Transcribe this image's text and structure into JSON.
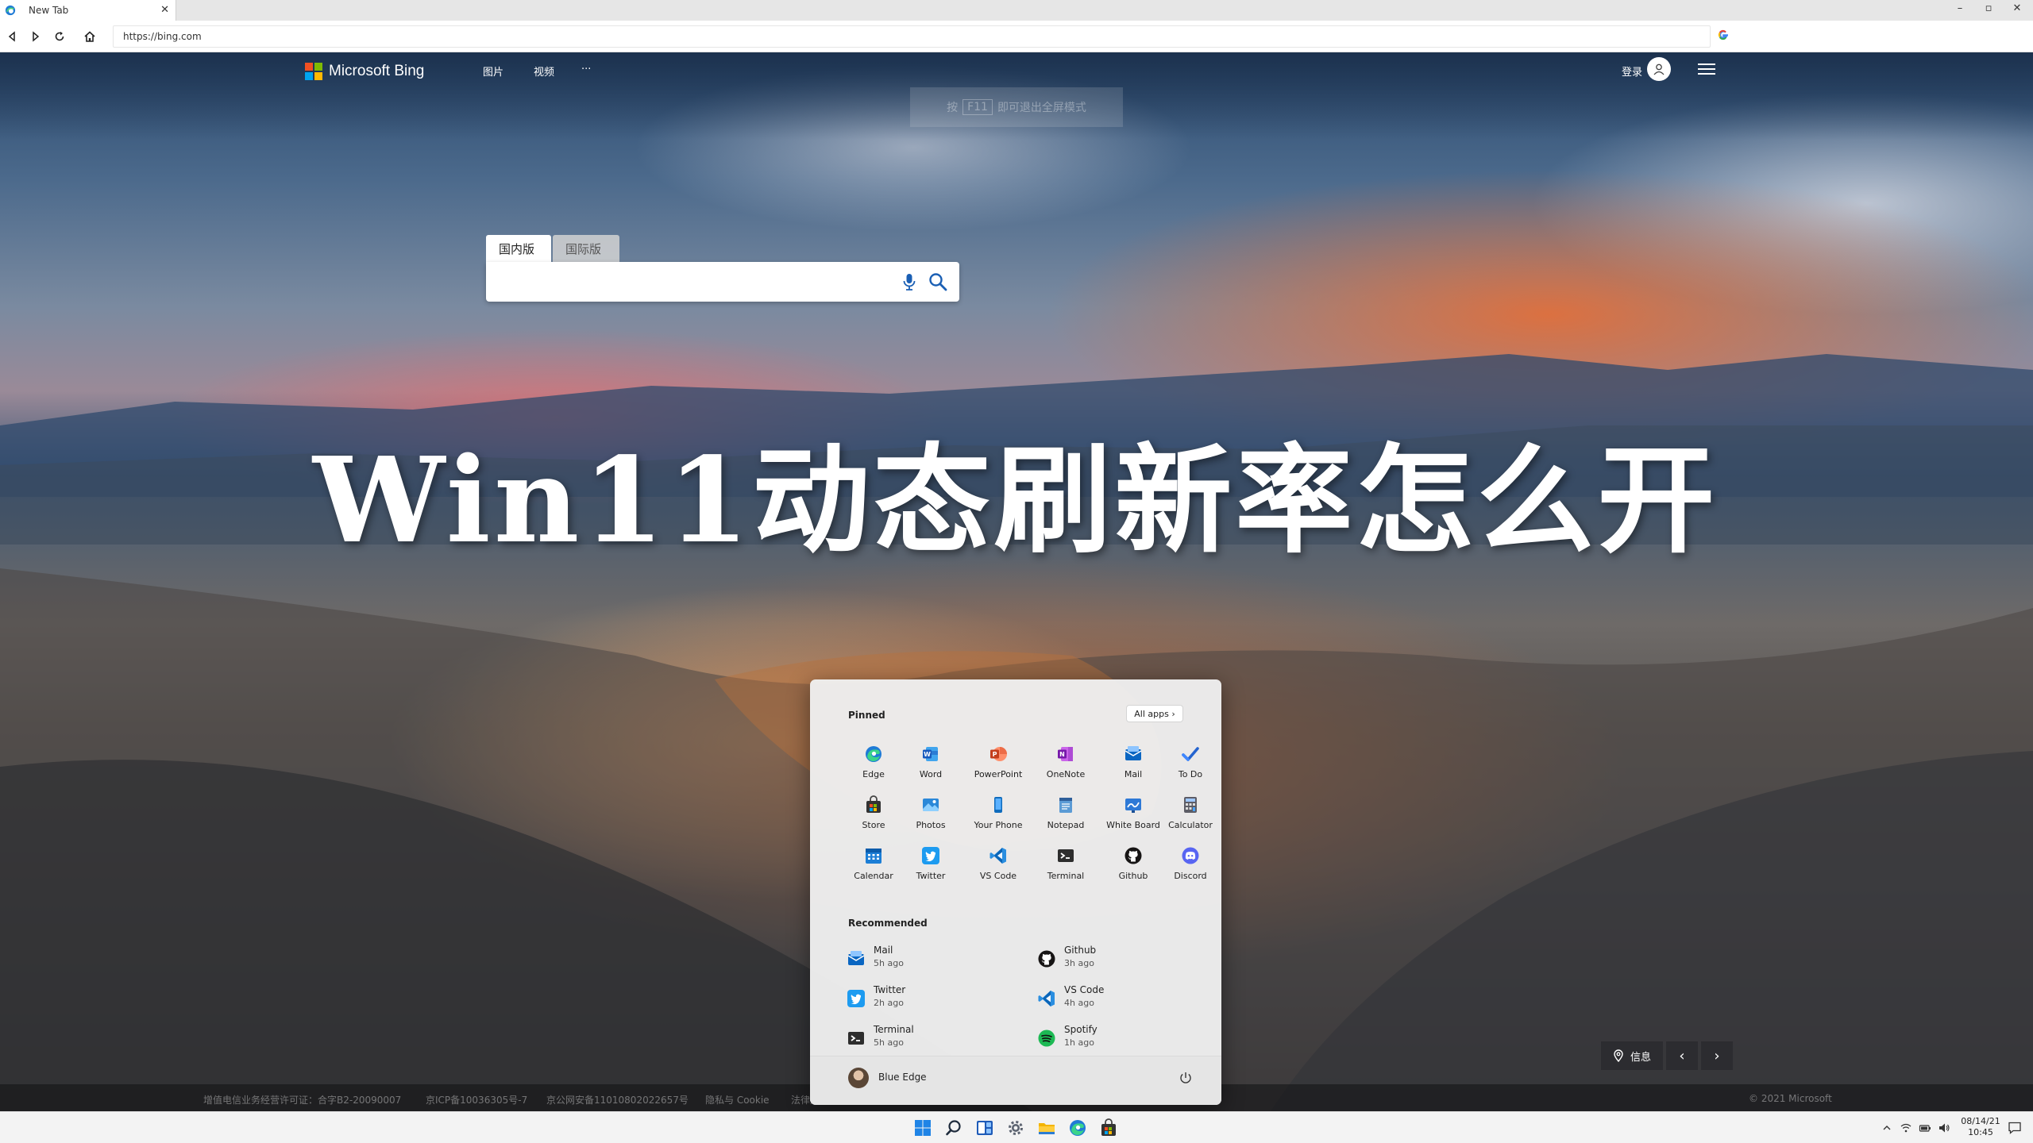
{
  "browser": {
    "tab_title": "New Tab",
    "tab_close": "✕",
    "url": "https://bing.com",
    "window_controls": [
      "–",
      "▫",
      "✕"
    ]
  },
  "bing": {
    "brand": "Microsoft Bing",
    "nav": [
      "图片",
      "视频",
      "···"
    ],
    "login": "登录",
    "scope_tabs": [
      "国内版",
      "国际版"
    ],
    "search_placeholder": "",
    "f11_toast": {
      "pre": "按",
      "key": "F11",
      "post": "即可退出全屏模式"
    },
    "headline": "Win11动态刷新率怎么开",
    "info": "信息",
    "footer": [
      "增值电信业务经营许可证：合字B2-20090007",
      "京ICP备10036305号-7",
      "京公网安备11010802022657号",
      "隐私与 Cookie",
      "法律声明"
    ],
    "copyright": "© 2021 Microsoft",
    "colors": {
      "ms_red": "#f25022",
      "ms_green": "#7fba00",
      "ms_blue": "#00a4ef",
      "ms_yellow": "#ffb900"
    }
  },
  "start_menu": {
    "pinned_label": "Pinned",
    "all_apps": "All apps ›",
    "pinned": [
      {
        "name": "Edge",
        "icon": "edge-icon"
      },
      {
        "name": "Word",
        "icon": "word-icon"
      },
      {
        "name": "PowerPoint",
        "icon": "powerpoint-icon"
      },
      {
        "name": "OneNote",
        "icon": "onenote-icon"
      },
      {
        "name": "Mail",
        "icon": "mail-icon"
      },
      {
        "name": "To Do",
        "icon": "todo-icon"
      },
      {
        "name": "Store",
        "icon": "store-icon"
      },
      {
        "name": "Photos",
        "icon": "photos-icon"
      },
      {
        "name": "Your Phone",
        "icon": "phone-icon"
      },
      {
        "name": "Notepad",
        "icon": "notepad-icon"
      },
      {
        "name": "White Board",
        "icon": "whiteboard-icon"
      },
      {
        "name": "Calculator",
        "icon": "calculator-icon"
      },
      {
        "name": "Calendar",
        "icon": "calendar-icon"
      },
      {
        "name": "Twitter",
        "icon": "twitter-icon"
      },
      {
        "name": "VS Code",
        "icon": "vscode-icon"
      },
      {
        "name": "Terminal",
        "icon": "terminal-icon"
      },
      {
        "name": "Github",
        "icon": "github-icon"
      },
      {
        "name": "Discord",
        "icon": "discord-icon"
      }
    ],
    "recommended_label": "Recommended",
    "recommended": [
      {
        "name": "Mail",
        "time": "5h ago",
        "icon": "mail-icon"
      },
      {
        "name": "Github",
        "time": "3h ago",
        "icon": "github-icon"
      },
      {
        "name": "Twitter",
        "time": "2h ago",
        "icon": "twitter-icon"
      },
      {
        "name": "VS Code",
        "time": "4h ago",
        "icon": "vscode-icon"
      },
      {
        "name": "Terminal",
        "time": "5h ago",
        "icon": "terminal-icon"
      },
      {
        "name": "Spotify",
        "time": "1h ago",
        "icon": "spotify-icon"
      }
    ],
    "user_name": "Blue Edge"
  },
  "taskbar": {
    "apps": [
      "start-icon",
      "search-icon",
      "widgets-icon",
      "settings-icon",
      "file-explorer-icon",
      "edge-icon",
      "store-icon"
    ],
    "date": "08/14/21",
    "time": "10:45"
  }
}
